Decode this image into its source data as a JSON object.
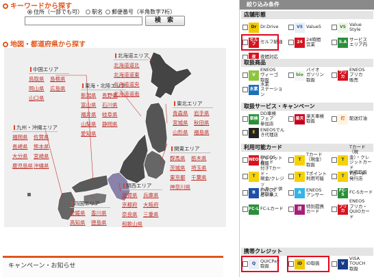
{
  "keyword": {
    "title": "キーワードから探す",
    "options": [
      "住所（一部でも可）",
      "駅名",
      "郵便番号（半角数字7桁）"
    ],
    "selected": 0,
    "input_value": "",
    "button": "検 索"
  },
  "map": {
    "title": "地図・都道府県から探す",
    "regions": [
      {
        "id": "hokkaido",
        "name": "北海道エリア",
        "prefs": [
          "北海道道北",
          "北海道道東",
          "北海道道央",
          "北海道道南"
        ]
      },
      {
        "id": "chugoku",
        "name": "中国エリア",
        "prefs": [
          "鳥取県",
          "島根県",
          "岡山県",
          "広島県",
          "山口県"
        ]
      },
      {
        "id": "tokai",
        "name": "東海・北陸エリア",
        "prefs": [
          "新潟県",
          "長野県",
          "富山県",
          "石川県",
          "福井県",
          "岐阜県",
          "山梨県",
          "静岡県",
          "愛知県"
        ]
      },
      {
        "id": "tohoku",
        "name": "東北エリア",
        "prefs": [
          "青森県",
          "岩手県",
          "宮城県",
          "秋田県",
          "山形県",
          "福島県"
        ]
      },
      {
        "id": "kyushu",
        "name": "九州・沖縄エリア",
        "prefs": [
          "福岡県",
          "佐賀県",
          "長崎県",
          "熊本県",
          "大分県",
          "宮崎県",
          "鹿児島県",
          "沖縄県"
        ]
      },
      {
        "id": "kanto",
        "name": "関東エリア",
        "prefs": [
          "群馬県",
          "栃木県",
          "茨城県",
          "埼玉県",
          "東京都",
          "千葉県",
          "神奈川県"
        ]
      },
      {
        "id": "kansai",
        "name": "関西エリア",
        "prefs": [
          "滋賀県",
          "兵庫県",
          "京都府",
          "大阪府",
          "奈良県",
          "三重県",
          "和歌山県"
        ]
      },
      {
        "id": "shikoku",
        "name": "四国エリア",
        "prefs": [
          "愛媛県",
          "香川県",
          "高知県",
          "徳島県"
        ]
      }
    ]
  },
  "campaign": {
    "title": "キャンペーン・お知らせ"
  },
  "filters": {
    "title": "絞り込み条件",
    "categories": [
      {
        "name": "店舗形態",
        "items": [
          {
            "label": "Dr.Drive",
            "logo": "Dr",
            "color": "#f0c800",
            "tcolor": "#222"
          },
          {
            "label": "Value5",
            "logo": "V5",
            "color": "#e8eef6",
            "tcolor": "#1a5cae"
          },
          {
            "label": "Value\nStyle",
            "logo": "VS",
            "color": "#eef5ea",
            "tcolor": "#3a7a2a"
          },
          {
            "label": "セルフ給油",
            "logo": "セルフ",
            "color": "#d5141f",
            "tcolor": "#fff"
          },
          {
            "label": "24時間\n営業",
            "logo": "24",
            "color": "#d5141f",
            "tcolor": "#fff"
          },
          {
            "label": "サービス\nエリア内",
            "logo": "S.A",
            "color": "#2b8f3a",
            "tcolor": "#fff"
          },
          {
            "label": "夜間対応",
            "logo": "夜",
            "color": "#d5141f",
            "tcolor": "#fff"
          }
        ]
      },
      {
        "name": "取扱商品",
        "items": [
          {
            "label": "ENEOS\nヴィーゴ\n取扱",
            "logo": "V",
            "color": "#8cc63f",
            "tcolor": "#fff"
          },
          {
            "label": "バイオ\nガソリン\n取扱",
            "logo": "bio",
            "color": "#f4f4f4",
            "tcolor": "#3a8a2a"
          },
          {
            "label": "ENEOS\nプリカ\n販売",
            "logo": "プリカ",
            "color": "#d5141f",
            "tcolor": "#fff"
          },
          {
            "label": "水素\nステーション",
            "logo": "水素",
            "color": "#1d6fb8",
            "tcolor": "#fff"
          }
        ]
      },
      {
        "name": "取扱サービス・キャンペーン",
        "items": [
          {
            "label": "DD車検\nフェア\n参加店",
            "logo": "車検",
            "color": "#2b8f3a",
            "tcolor": "#fff"
          },
          {
            "label": "楽天車検\n取扱",
            "logo": "楽天",
            "color": "#c4001a",
            "tcolor": "#fff"
          },
          {
            "label": "配送灯油",
            "logo": "灯",
            "color": "#fff4e0",
            "tcolor": "#e0561b"
          },
          {
            "label": "ENEOSでんき代理店",
            "logo": "E",
            "color": "#222",
            "tcolor": "#f0c800"
          }
        ]
      },
      {
        "name": "利用可能カード",
        "items": [
          {
            "label": "ENEOS\nカード",
            "logo": "ENEOS",
            "color": "#d5141f",
            "tcolor": "#fff"
          },
          {
            "label": "Tカード\n（現金）\n取扱",
            "logo": "T",
            "color": "#f6d200",
            "tcolor": "#1a3a8a"
          },
          {
            "label": "Tカード（現\n金）・クレ\nジットカード\n併用取扱",
            "logo": "T",
            "color": "#f6d200",
            "tcolor": "#1a3a8a"
          },
          {
            "label": "クレジット機能\n付きTカード・\n現金/クレジッ\nトカード併用取扱",
            "logo": "T",
            "color": "#f6d200",
            "tcolor": "#1a3a8a"
          },
          {
            "label": "Tポイント\n利用可能",
            "logo": "T",
            "color": "#f6d200",
            "tcolor": "#1a3a8a"
          },
          {
            "label": "Tカード\n発行店",
            "logo": "T",
            "color": "#f6d200",
            "tcolor": "#1a3a8a"
          },
          {
            "label": "ENEOS\nビジネス",
            "logo": "B",
            "color": "#1d4fa8",
            "tcolor": "#fff"
          },
          {
            "label": "ENEOS\nアンサー",
            "logo": "A",
            "color": "#35b5e5",
            "tcolor": "#fff"
          },
          {
            "label": "FC-Sカード",
            "logo": "FC-S",
            "color": "#2b8f3a",
            "tcolor": "#fff"
          },
          {
            "label": "FC-Lカード",
            "logo": "FC-L",
            "color": "#2b8f3a",
            "tcolor": "#fff"
          },
          {
            "label": "特別提携\nカード",
            "logo": "提",
            "color": "#a61e78",
            "tcolor": "#fff"
          },
          {
            "label": "ENEOS\nプリカ・\nQUIOカード",
            "logo": "プリカ",
            "color": "#d5141f",
            "tcolor": "#fff"
          }
        ]
      },
      {
        "name": "携帯クレジット",
        "items": [
          {
            "label": "QUICPay\n取扱",
            "logo": "Q",
            "color": "#e9eef6",
            "tcolor": "#1a3a8a"
          },
          {
            "label": "iD取扱",
            "logo": "iD",
            "color": "#f0c800",
            "tcolor": "#222"
          },
          {
            "label": "VISA\nTOUCH\n取扱",
            "logo": "V",
            "color": "#1a3a8a",
            "tcolor": "#fff"
          }
        ]
      }
    ]
  }
}
